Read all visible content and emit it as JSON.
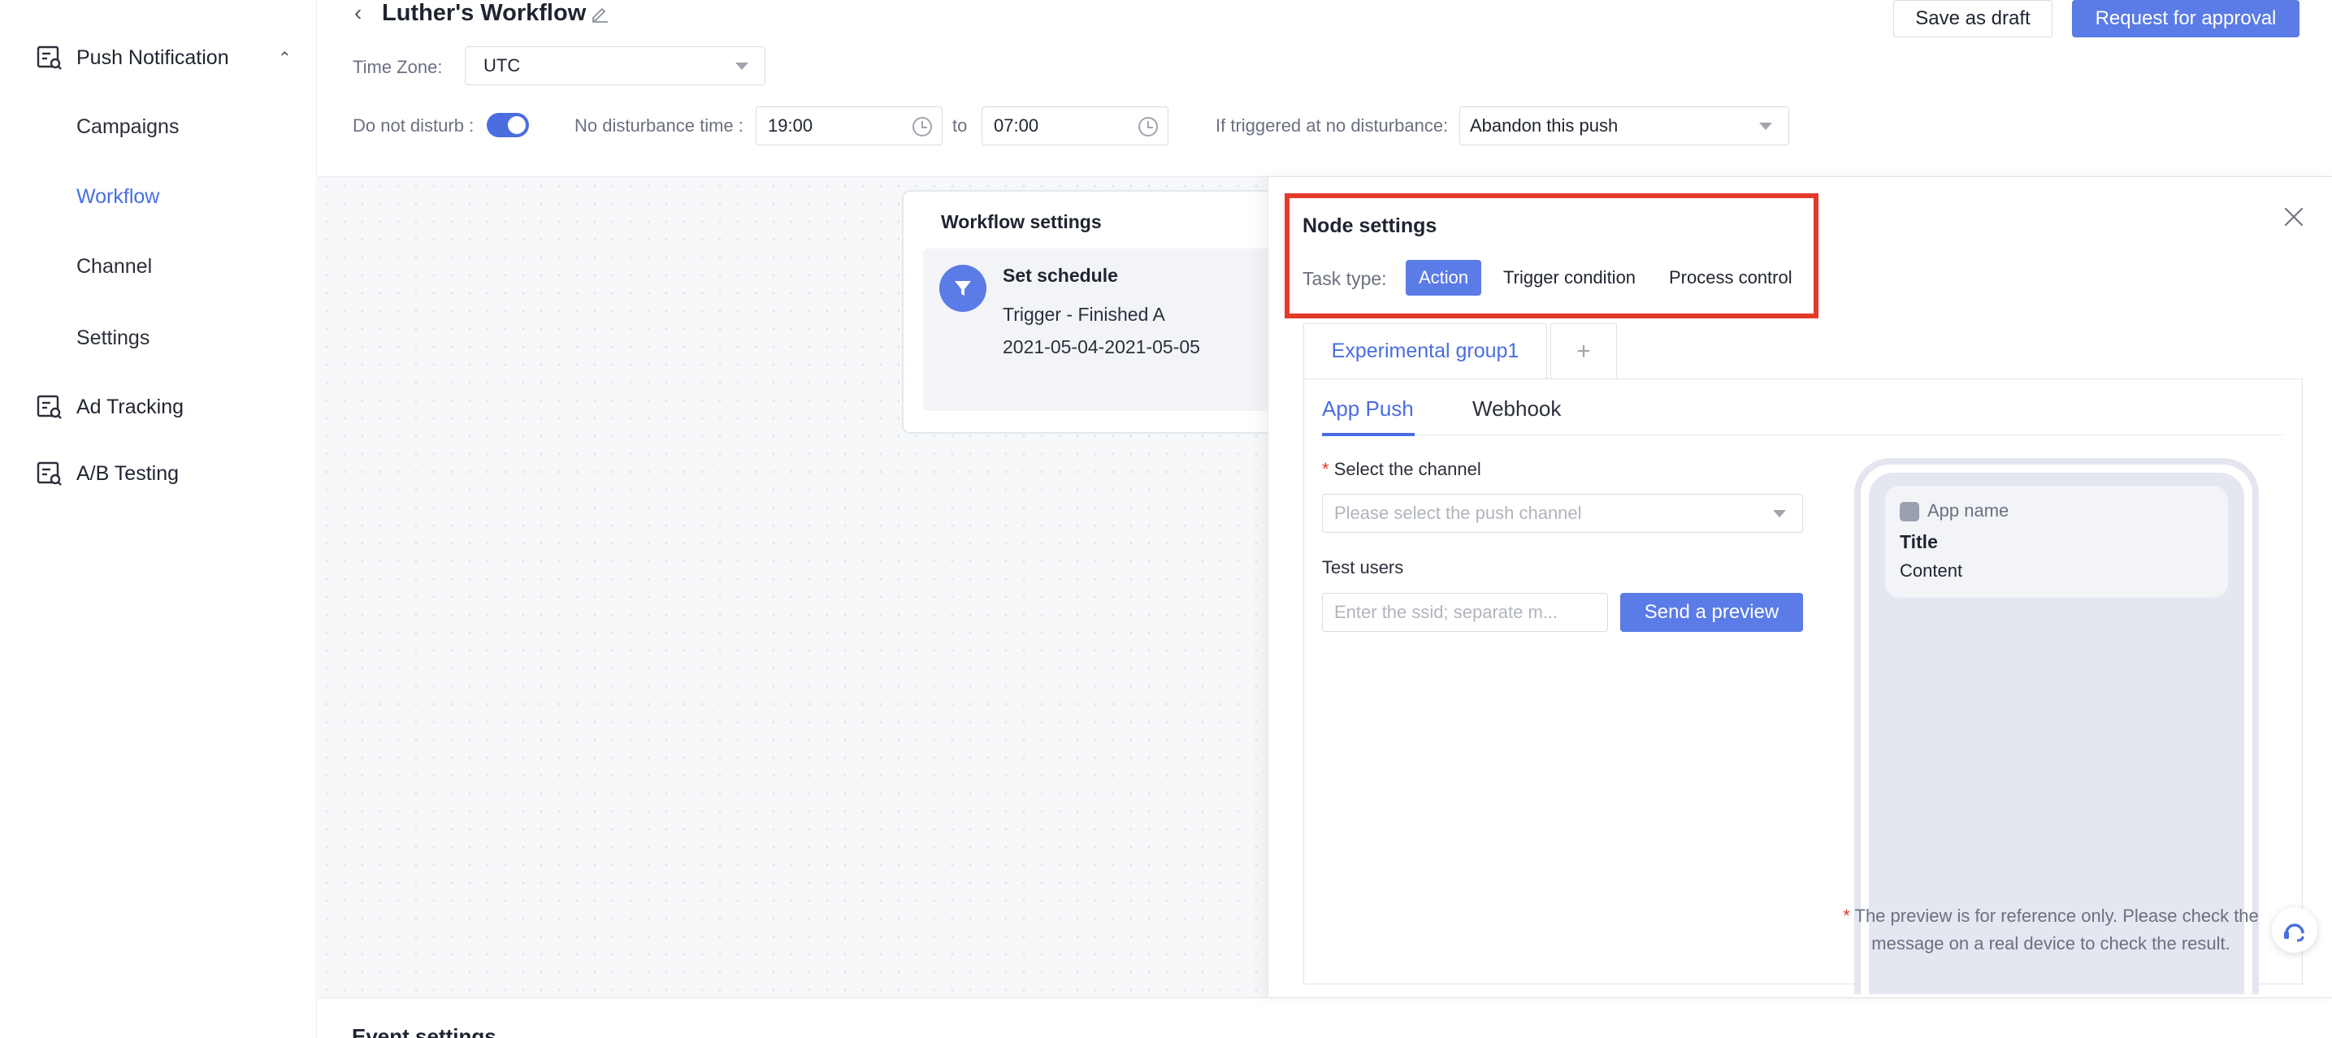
{
  "sidebar": {
    "push_notification": "Push Notification",
    "campaigns": "Campaigns",
    "workflow": "Workflow",
    "channel": "Channel",
    "settings": "Settings",
    "ad_tracking": "Ad Tracking",
    "ab_testing": "A/B Testing"
  },
  "header": {
    "title": "Luther's Workflow",
    "save_draft": "Save as draft",
    "request_approval": "Request for approval",
    "timezone_label": "Time Zone:",
    "timezone_value": "UTC",
    "dnd_label": "Do not disturb :",
    "no_disturb_label": "No disturbance time :",
    "start_time": "19:00",
    "to_label": "to",
    "end_time": "07:00",
    "triggered_label": "If triggered at no disturbance:",
    "triggered_value": "Abandon this push"
  },
  "workflow_card": {
    "title": "Workflow settings",
    "step_title": "Set schedule",
    "step_trigger": "Trigger - Finished A",
    "step_dates": "2021-05-04-2021-05-05"
  },
  "node_settings": {
    "title": "Node settings",
    "task_type_label": "Task type:",
    "task_types": [
      "Action",
      "Trigger condition",
      "Process control"
    ],
    "group_tab": "Experimental group1",
    "add_tab": "+",
    "sub_tabs": [
      "App Push",
      "Webhook"
    ],
    "required_mark": "*",
    "channel_label": "Select the channel",
    "channel_placeholder": "Please select the push channel",
    "test_users_label": "Test users",
    "test_users_placeholder": "Enter the ssid; separate m...",
    "send_preview": "Send a preview",
    "preview": {
      "app_name": "App name",
      "title": "Title",
      "content": "Content"
    },
    "note_line1": "The preview is for reference only. Please check the",
    "note_line2": "message on a real device to check the result."
  },
  "bottom_partial": "Event settings",
  "colors": {
    "accent": "#5b7be6",
    "highlight": "#e53a2a"
  }
}
